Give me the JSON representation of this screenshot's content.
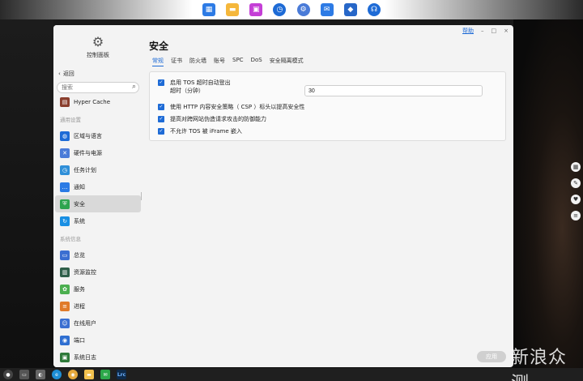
{
  "dock": {
    "icons": [
      "grid-icon",
      "folder-icon",
      "photos-icon",
      "clock-icon",
      "gear-icon",
      "mail-icon",
      "store-icon",
      "headset-icon"
    ]
  },
  "window": {
    "help_label": "帮助",
    "minimize_label": "–",
    "maximize_label": "□",
    "close_label": "×"
  },
  "sidebar": {
    "app_title": "控制面板",
    "back_label": "返回",
    "search_placeholder": "搜索",
    "items": [
      {
        "type": "item",
        "label": "Hyper Cache",
        "icon": "cache-icon",
        "color": "#8a3f2e"
      },
      {
        "type": "group",
        "label": "通用设置"
      },
      {
        "type": "item",
        "label": "区域与语言",
        "icon": "globe-icon",
        "color": "#1e6bd6"
      },
      {
        "type": "item",
        "label": "硬件与电源",
        "icon": "tools-icon",
        "color": "#4a7bd8"
      },
      {
        "type": "item",
        "label": "任务计划",
        "icon": "schedule-icon",
        "color": "#2f8fd8"
      },
      {
        "type": "item",
        "label": "通知",
        "icon": "chat-icon",
        "color": "#2c7be5"
      },
      {
        "type": "item",
        "label": "安全",
        "icon": "shield-icon",
        "color": "#2ea44f",
        "active": true
      },
      {
        "type": "item",
        "label": "系统",
        "icon": "refresh-icon",
        "color": "#1a8fe3"
      },
      {
        "type": "group",
        "label": "系统信息"
      },
      {
        "type": "item",
        "label": "总览",
        "icon": "monitor-icon",
        "color": "#3b6fd1"
      },
      {
        "type": "item",
        "label": "资源监控",
        "icon": "chart-icon",
        "color": "#2f5f4a"
      },
      {
        "type": "item",
        "label": "服务",
        "icon": "service-icon",
        "color": "#4caf50"
      },
      {
        "type": "item",
        "label": "进程",
        "icon": "process-icon",
        "color": "#e07b2a"
      },
      {
        "type": "item",
        "label": "在线用户",
        "icon": "users-icon",
        "color": "#3b6fd1"
      },
      {
        "type": "item",
        "label": "端口",
        "icon": "port-icon",
        "color": "#2f6fd1"
      },
      {
        "type": "item",
        "label": "系统日志",
        "icon": "log-icon",
        "color": "#2f7a3a"
      }
    ]
  },
  "main": {
    "title": "安全",
    "tabs": [
      "常规",
      "证书",
      "防火墙",
      "账号",
      "SPC",
      "DoS",
      "安全隔离模式"
    ],
    "active_tab": "常规",
    "options": {
      "auto_logout": "启用 TOS 超时自动登出",
      "timeout_label": "超时（分钟）",
      "timeout_value": "30",
      "csp": "使用 HTTP 内容安全策略（ CSP ）标头以提高安全性",
      "cross_site": "提高对跨网站伪造请求攻击的防御能力",
      "iframe": "不允许 TOS 被 iFrame 嵌入"
    },
    "apply_label": "应用"
  },
  "right_tools": [
    "qr-icon",
    "comment-icon",
    "like-icon",
    "menu-icon"
  ],
  "taskbar": {
    "icons": [
      "start-icon",
      "taskview-icon",
      "chrome-icon",
      "edge-icon",
      "chrome-alt-icon",
      "explorer-icon",
      "wechat-icon",
      "lrc-icon"
    ],
    "lrc_label": "Lrc"
  },
  "watermark": "新浪众测"
}
